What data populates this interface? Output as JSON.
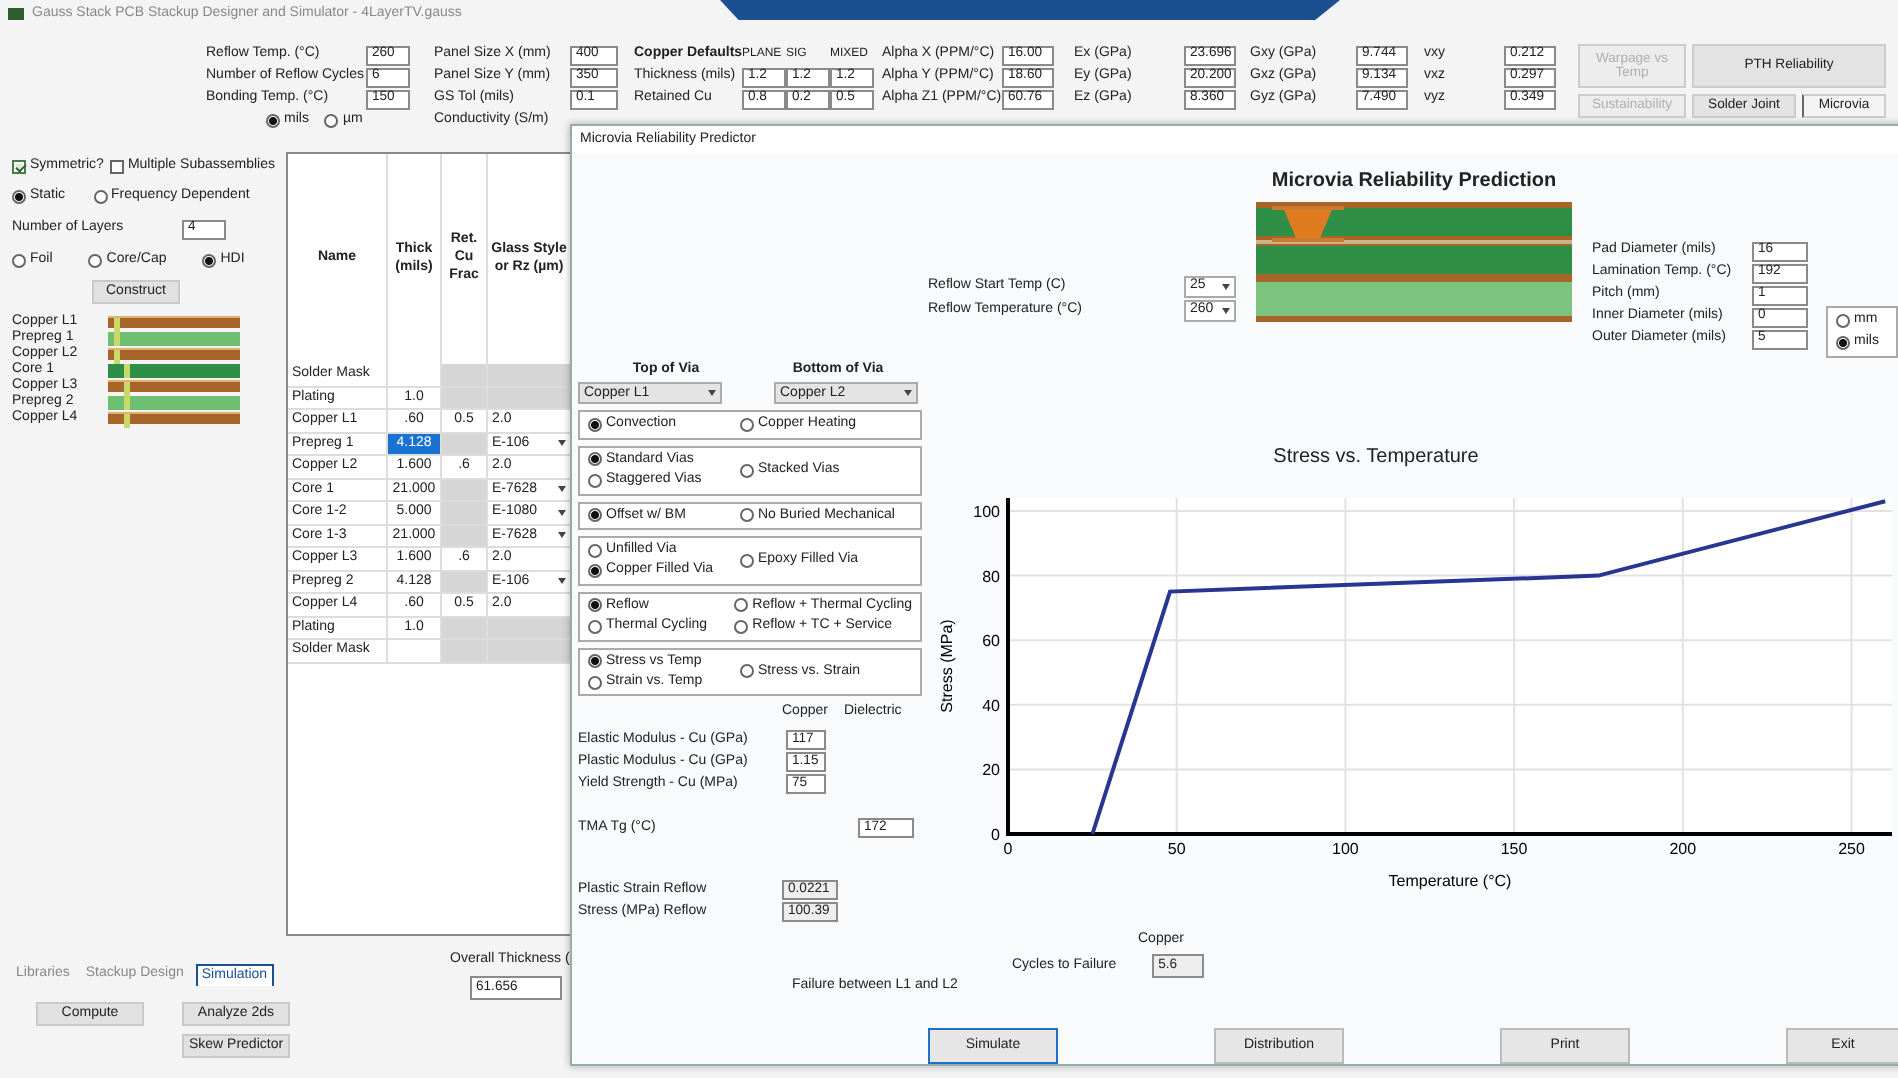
{
  "app": {
    "title": "Gauss Stack PCB Stackup Designer and Simulator - 4LayerTV.gauss"
  },
  "parameters": [
    {
      "kind": "fields",
      "rows": [
        {
          "label": "Reflow Temp. (°C)",
          "value": "260"
        },
        {
          "label": "Number of Reflow Cycles",
          "value": "6"
        },
        {
          "label": "Bonding Temp. (°C)",
          "value": "150"
        }
      ],
      "units": [
        {
          "label": "mils",
          "selected": true
        },
        {
          "label": "µm",
          "selected": false
        }
      ]
    },
    {
      "kind": "fields",
      "rows": [
        {
          "label": "Panel Size X (mm)",
          "value": "400"
        },
        {
          "label": "Panel Size Y (mm)",
          "value": "350"
        },
        {
          "label": "GS Tol (mils)",
          "value": "0.1"
        },
        {
          "label": "Conductivity (S/m)"
        }
      ]
    },
    {
      "kind": "grid",
      "title": "Copper Defaults",
      "columns": [
        "PLANE",
        "SIG",
        "MIXED"
      ],
      "rows": [
        {
          "label": "Thickness (mils)",
          "values": [
            "1.2",
            "1.2",
            "1.2"
          ]
        },
        {
          "label": "Retained Cu",
          "values": [
            "0.8",
            "0.2",
            "0.5"
          ]
        }
      ]
    },
    {
      "kind": "fields",
      "rows": [
        {
          "label": "Alpha X (PPM/°C)",
          "value": "16.00"
        },
        {
          "label": "Alpha Y (PPM/°C)",
          "value": "18.60"
        },
        {
          "label": "Alpha Z1 (PPM/°C)",
          "value": "60.76"
        }
      ]
    },
    {
      "kind": "fields",
      "rows": [
        {
          "label": "Ex (GPa)",
          "value": "23.696"
        },
        {
          "label": "Ey (GPa)",
          "value": "20.200"
        },
        {
          "label": "Ez (GPa)",
          "value": "8.360"
        }
      ]
    },
    {
      "kind": "fields",
      "rows": [
        {
          "label": "Gxy (GPa)",
          "value": "9.744"
        },
        {
          "label": "Gxz (GPa)",
          "value": "9.134"
        },
        {
          "label": "Gyz (GPa)",
          "value": "7.490"
        }
      ]
    },
    {
      "kind": "fields",
      "rows": [
        {
          "label": "vxy",
          "value": "0.212"
        },
        {
          "label": "vxz",
          "value": "0.297"
        },
        {
          "label": "vyz",
          "value": "0.349"
        }
      ]
    }
  ],
  "tool_buttons": [
    {
      "label": "Warpage vs Temp",
      "disabled": true
    },
    {
      "label": "PTH Reliability",
      "disabled": false
    },
    {
      "label": "Sustainability",
      "disabled": true
    },
    {
      "label": "Solder Joint",
      "disabled": false
    },
    {
      "label": "Microvia",
      "disabled": false
    }
  ],
  "left_panel": {
    "checkboxes": [
      {
        "label": "Symmetric?",
        "checked": true
      },
      {
        "label": "Multiple Subassemblies",
        "checked": false
      }
    ],
    "analysis": [
      {
        "label": "Static",
        "selected": true
      },
      {
        "label": "Frequency Dependent",
        "selected": false
      }
    ],
    "layers_label": "Number of Layers",
    "layers_value": "4",
    "construction": [
      {
        "label": "Foil",
        "selected": false
      },
      {
        "label": "Core/Cap",
        "selected": false
      },
      {
        "label": "HDI",
        "selected": true
      }
    ],
    "construct_button": "Construct",
    "layers": [
      {
        "name": "Copper L1",
        "kind": "copper"
      },
      {
        "name": "Prepreg 1",
        "kind": "prepreg"
      },
      {
        "name": "Copper L2",
        "kind": "copper"
      },
      {
        "name": "Core 1",
        "kind": "core"
      },
      {
        "name": "Copper L3",
        "kind": "copper"
      },
      {
        "name": "Prepreg 2",
        "kind": "prepreg"
      },
      {
        "name": "Copper L4",
        "kind": "copper"
      }
    ]
  },
  "stackup_table": {
    "columns": [
      "Name",
      "Thick (mils)",
      "Ret. Cu Frac",
      "Glass Style or Rz (µm)"
    ],
    "rows": [
      {
        "name": "Solder Mask",
        "kind": "mask",
        "selected": false
      },
      {
        "name": "Plating",
        "thick": "1.0",
        "kind": "mask",
        "selected": false
      },
      {
        "name": "Copper L1",
        "thick": ".60",
        "ret": "0.5",
        "glass": "2.0",
        "kind": "copper",
        "selected": false
      },
      {
        "name": "Prepreg 1",
        "thick": "4.128",
        "glass": "E-106",
        "kind": "dielectric",
        "selected": true
      },
      {
        "name": "Copper L2",
        "thick": "1.600",
        "ret": ".6",
        "glass": "2.0",
        "kind": "copper",
        "selected": false
      },
      {
        "name": "Core 1",
        "thick": "21.000",
        "glass": "E-7628",
        "kind": "dielectric",
        "selected": false
      },
      {
        "name": "Core 1-2",
        "thick": "5.000",
        "glass": "E-1080",
        "kind": "dielectric",
        "selected": false
      },
      {
        "name": "Core 1-3",
        "thick": "21.000",
        "glass": "E-7628",
        "kind": "dielectric",
        "selected": false
      },
      {
        "name": "Copper L3",
        "thick": "1.600",
        "ret": ".6",
        "glass": "2.0",
        "kind": "copper",
        "selected": false
      },
      {
        "name": "Prepreg 2",
        "thick": "4.128",
        "glass": "E-106",
        "kind": "dielectric",
        "selected": false
      },
      {
        "name": "Copper L4",
        "thick": ".60",
        "ret": "0.5",
        "glass": "2.0",
        "kind": "copper",
        "selected": false
      },
      {
        "name": "Plating",
        "thick": "1.0",
        "kind": "mask",
        "selected": false
      },
      {
        "name": "Solder Mask",
        "kind": "mask",
        "selected": false
      }
    ]
  },
  "bottom_tabs": [
    {
      "label": "Libraries",
      "selected": false
    },
    {
      "label": "Stackup Design",
      "selected": false
    },
    {
      "label": "Simulation",
      "selected": true
    }
  ],
  "bottom_buttons": [
    "Compute",
    "Analyze 2ds",
    "Skew Predictor"
  ],
  "overall_thickness": {
    "label": "Overall Thickness (",
    "value": "61.656"
  },
  "dialog": {
    "title": "Microvia Reliability Predictor",
    "heading": "Microvia Reliability Prediction",
    "reflow": [
      {
        "label": "Reflow Start Temp (C)",
        "value": "25"
      },
      {
        "label": "Reflow Temperature (°C)",
        "value": "260"
      }
    ],
    "via_params": [
      {
        "label": "Pad Diameter (mils)",
        "value": "16"
      },
      {
        "label": "Lamination Temp. (°C)",
        "value": "192"
      },
      {
        "label": "Pitch (mm)",
        "value": "1"
      },
      {
        "label": "Inner Diameter (mils)",
        "value": "0"
      },
      {
        "label": "Outer Diameter (mils)",
        "value": "5"
      }
    ],
    "units": [
      {
        "label": "mm",
        "selected": false
      },
      {
        "label": "mils",
        "selected": true
      }
    ],
    "via_layers": [
      {
        "label": "Top of Via",
        "value": "Copper L1"
      },
      {
        "label": "Bottom of Via",
        "value": "Copper L2"
      }
    ],
    "option_groups": [
      {
        "columns": [
          [
            {
              "label": "Convection",
              "selected": true
            }
          ],
          [
            {
              "label": "Copper Heating",
              "selected": false
            }
          ]
        ]
      },
      {
        "columns": [
          [
            {
              "label": "Standard Vias",
              "selected": true
            },
            {
              "label": "Staggered Vias",
              "selected": false
            }
          ],
          [
            {
              "label": "Stacked Vias",
              "selected": false
            }
          ]
        ]
      },
      {
        "columns": [
          [
            {
              "label": "Offset w/ BM",
              "selected": true
            }
          ],
          [
            {
              "label": "No Buried Mechanical",
              "selected": false
            }
          ]
        ]
      },
      {
        "columns": [
          [
            {
              "label": "Unfilled Via",
              "selected": false
            },
            {
              "label": "Copper Filled Via",
              "selected": true
            }
          ],
          [
            {
              "label": "Epoxy Filled Via",
              "selected": false
            }
          ]
        ]
      },
      {
        "columns": [
          [
            {
              "label": "Reflow",
              "selected": true
            },
            {
              "label": "Thermal Cycling",
              "selected": false
            }
          ],
          [
            {
              "label": "Reflow + Thermal Cycling",
              "selected": false
            },
            {
              "label": "Reflow + TC + Service",
              "selected": false
            }
          ]
        ]
      },
      {
        "columns": [
          [
            {
              "label": "Stress vs Temp",
              "selected": true
            },
            {
              "label": "Strain vs. Temp",
              "selected": false
            }
          ],
          [
            {
              "label": "Stress vs. Strain",
              "selected": false
            }
          ]
        ]
      }
    ],
    "material_headers": [
      "Copper",
      "Dielectric"
    ],
    "material": [
      {
        "label": "Elastic Modulus - Cu (GPa)",
        "value": "117"
      },
      {
        "label": "Plastic Modulus - Cu (GPa)",
        "value": "1.15"
      },
      {
        "label": "Yield Strength - Cu (MPa)",
        "value": "75"
      }
    ],
    "tma": {
      "label": "TMA Tg (°C)",
      "value": "172"
    },
    "results": [
      {
        "label": "Plastic Strain Reflow",
        "value": "0.0221"
      },
      {
        "label": "Stress (MPa) Reflow",
        "value": "100.39"
      }
    ],
    "chart_data": {
      "type": "line",
      "title": "Stress vs. Temperature",
      "xlabel": "Temperature (°C)",
      "ylabel": "Stress (MPa)",
      "x": [
        25,
        48,
        175,
        260
      ],
      "series": [
        {
          "color": "#283593",
          "values": [
            0,
            75,
            80,
            103
          ]
        }
      ],
      "grid": true,
      "xlim": [
        0,
        262
      ],
      "ylim": [
        0,
        104
      ],
      "xticks": [
        0,
        50,
        100,
        150,
        200,
        250
      ],
      "yticks": [
        0,
        20,
        40,
        60,
        80,
        100
      ]
    },
    "cycles": {
      "header": "Copper",
      "label": "Cycles to Failure",
      "value": "5.6"
    },
    "failure": "Failure between L1 and L2",
    "buttons": [
      {
        "label": "Simulate",
        "default": true
      },
      {
        "label": "Distribution",
        "default": false
      },
      {
        "label": "Print",
        "default": false
      },
      {
        "label": "Exit",
        "default": false
      }
    ]
  }
}
